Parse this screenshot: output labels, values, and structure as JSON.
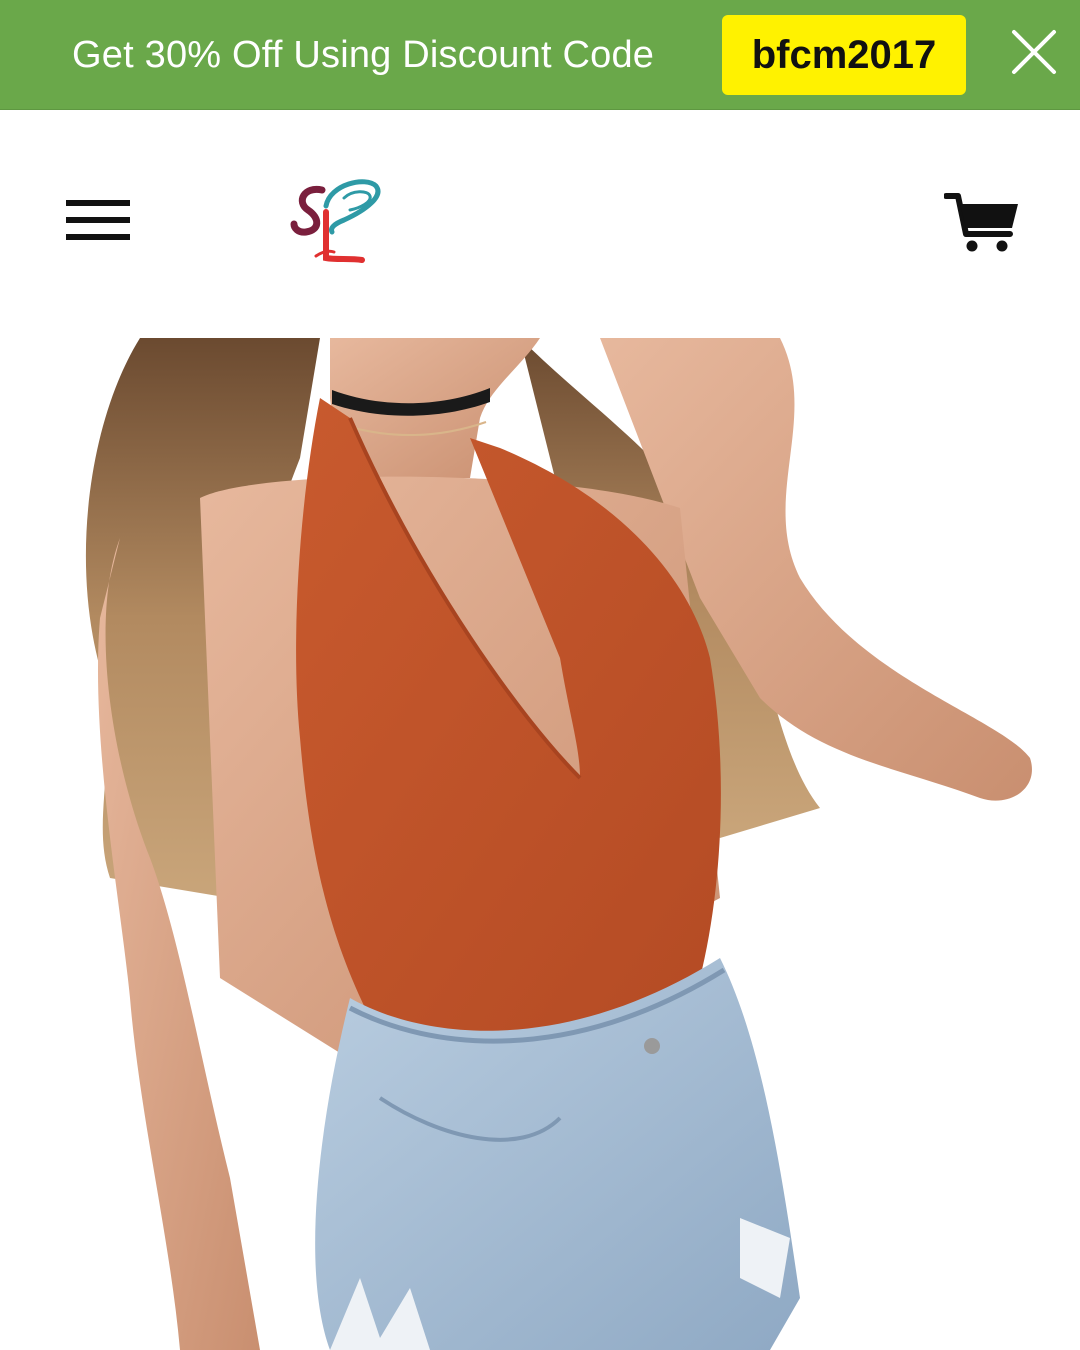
{
  "promo": {
    "text": "Get 30% Off Using Discount Code",
    "code": "bfcm2017",
    "close_icon": "close-icon",
    "background_color": "#6aa84a",
    "code_background_color": "#fff200"
  },
  "header": {
    "menu_icon": "hamburger-menu-icon",
    "logo_icon": "sl-heart-logo",
    "cart_icon": "shopping-cart-icon"
  },
  "product": {
    "image_subject": "product-photo"
  }
}
